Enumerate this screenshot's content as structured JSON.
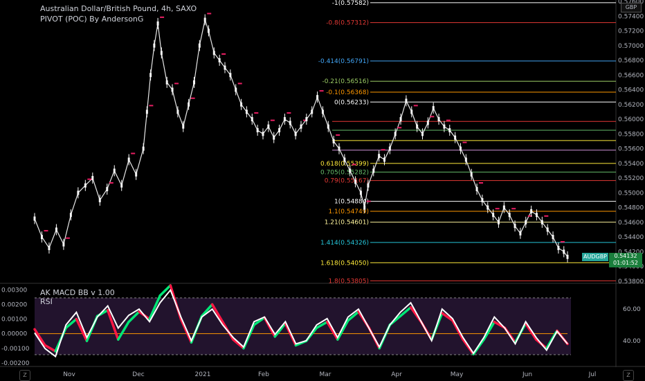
{
  "header": {
    "symbol_line": "Australian Dollar/British Pound, 4h, SAXO",
    "indicator_line": "PIVOT (POC) By AndersonG",
    "macd_label": "AK MACD BB v 1.00",
    "rsi_label": "RSI"
  },
  "axis": {
    "currency": "GBP",
    "symbol_tag": "AUDGBP",
    "last_price": "0.54132",
    "countdown": "01:01:52",
    "zoom_left": "Z",
    "zoom_right": "Z"
  },
  "colors": {
    "background": "#000000",
    "candle_up": "#ffffff",
    "candle_down": "#ffffff",
    "pivot_marker": "#e91e63",
    "macd_up": "#00e676",
    "macd_down": "#ff1744",
    "rsi_line": "#ffffff",
    "rsi_band": "#3b1f4d"
  },
  "chart_data": {
    "type": "line",
    "x_ticks": [
      "Nov",
      "Dec",
      "2021",
      "Feb",
      "Mar",
      "Apr",
      "May",
      "Jun",
      "Jul"
    ],
    "price_ylim": [
      0.5378,
      0.576
    ],
    "price_ticks": [
      "0.57600",
      "0.57400",
      "0.57200",
      "0.57000",
      "0.56800",
      "0.56600",
      "0.56400",
      "0.56200",
      "0.56000",
      "0.55800",
      "0.55600",
      "0.55400",
      "0.55200",
      "0.55000",
      "0.54800",
      "0.54600",
      "0.54400",
      "0.54200",
      "0.54000",
      "0.53800"
    ],
    "price_path": [
      [
        0,
        0.5465
      ],
      [
        8,
        0.544
      ],
      [
        16,
        0.5425
      ],
      [
        24,
        0.545
      ],
      [
        32,
        0.543
      ],
      [
        40,
        0.547
      ],
      [
        48,
        0.55
      ],
      [
        56,
        0.551
      ],
      [
        64,
        0.552
      ],
      [
        72,
        0.549
      ],
      [
        80,
        0.5505
      ],
      [
        88,
        0.553
      ],
      [
        96,
        0.551
      ],
      [
        104,
        0.5545
      ],
      [
        112,
        0.5525
      ],
      [
        120,
        0.556
      ],
      [
        124,
        0.561
      ],
      [
        128,
        0.566
      ],
      [
        132,
        0.57
      ],
      [
        136,
        0.573
      ],
      [
        140,
        0.569
      ],
      [
        146,
        0.565
      ],
      [
        152,
        0.564
      ],
      [
        158,
        0.561
      ],
      [
        164,
        0.559
      ],
      [
        170,
        0.562
      ],
      [
        176,
        0.565
      ],
      [
        182,
        0.57
      ],
      [
        188,
        0.5735
      ],
      [
        192,
        0.572
      ],
      [
        198,
        0.569
      ],
      [
        204,
        0.568
      ],
      [
        210,
        0.567
      ],
      [
        216,
        0.566
      ],
      [
        222,
        0.564
      ],
      [
        228,
        0.562
      ],
      [
        234,
        0.561
      ],
      [
        240,
        0.56
      ],
      [
        246,
        0.5585
      ],
      [
        252,
        0.558
      ],
      [
        258,
        0.559
      ],
      [
        264,
        0.5575
      ],
      [
        270,
        0.5585
      ],
      [
        276,
        0.56
      ],
      [
        282,
        0.5595
      ],
      [
        288,
        0.558
      ],
      [
        294,
        0.559
      ],
      [
        300,
        0.56
      ],
      [
        306,
        0.561
      ],
      [
        312,
        0.563
      ],
      [
        318,
        0.561
      ],
      [
        324,
        0.559
      ],
      [
        330,
        0.557
      ],
      [
        336,
        0.556
      ],
      [
        342,
        0.5545
      ],
      [
        348,
        0.553
      ],
      [
        354,
        0.5515
      ],
      [
        360,
        0.55
      ],
      [
        364,
        0.548
      ],
      [
        368,
        0.551
      ],
      [
        374,
        0.553
      ],
      [
        380,
        0.555
      ],
      [
        386,
        0.5545
      ],
      [
        392,
        0.556
      ],
      [
        398,
        0.558
      ],
      [
        404,
        0.56
      ],
      [
        410,
        0.5625
      ],
      [
        416,
        0.561
      ],
      [
        422,
        0.559
      ],
      [
        428,
        0.558
      ],
      [
        434,
        0.5595
      ],
      [
        440,
        0.5615
      ],
      [
        446,
        0.56
      ],
      [
        452,
        0.559
      ],
      [
        458,
        0.5585
      ],
      [
        464,
        0.5575
      ],
      [
        470,
        0.556
      ],
      [
        476,
        0.5545
      ],
      [
        482,
        0.5525
      ],
      [
        488,
        0.5505
      ],
      [
        494,
        0.549
      ],
      [
        500,
        0.548
      ],
      [
        506,
        0.547
      ],
      [
        512,
        0.546
      ],
      [
        518,
        0.548
      ],
      [
        524,
        0.547
      ],
      [
        530,
        0.5455
      ],
      [
        536,
        0.5445
      ],
      [
        542,
        0.546
      ],
      [
        548,
        0.5475
      ],
      [
        554,
        0.547
      ],
      [
        560,
        0.546
      ],
      [
        566,
        0.545
      ],
      [
        572,
        0.544
      ],
      [
        578,
        0.5425
      ],
      [
        584,
        0.542
      ],
      [
        588,
        0.5413
      ]
    ],
    "fib_levels": [
      {
        "label": "-1(0.57582)",
        "value": 0.57582,
        "color": "#ffffff"
      },
      {
        "label": "-0.8(0.57312)",
        "value": 0.57312,
        "color": "#e53935"
      },
      {
        "label": "-0.414(0.56791)",
        "value": 0.56791,
        "color": "#42a5f5"
      },
      {
        "label": "-0.21(0.56516)",
        "value": 0.56516,
        "color": "#9ccc65"
      },
      {
        "label": "-0.1(0.56368)",
        "value": 0.56368,
        "color": "#ff9800"
      },
      {
        "label": "0(0.56233)",
        "value": 0.56233,
        "color": "#ffffff"
      },
      {
        "label": "0.618(0.55399)",
        "value": 0.55399,
        "color": "#ffeb3b"
      },
      {
        "label": "0.705(0.55282)",
        "value": 0.55282,
        "color": "#66bb6a"
      },
      {
        "label": "0.79(0.55167)",
        "value": 0.55167,
        "color": "#e53935"
      },
      {
        "label": "1(0.54884)",
        "value": 0.54884,
        "color": "#ffffff"
      },
      {
        "label": "1.1(0.54749)",
        "value": 0.54749,
        "color": "#ff9800"
      },
      {
        "label": "1.21(0.54601)",
        "value": 0.54601,
        "color": "#fff59d"
      },
      {
        "label": "1.414(0.54326)",
        "value": 0.54326,
        "color": "#26c6da"
      },
      {
        "label": "1.618(0.54050)",
        "value": 0.5405,
        "color": "#ffeb3b"
      },
      {
        "label": "1.8(0.53805)",
        "value": 0.53805,
        "color": "#e53935"
      }
    ],
    "extra_level_lines": [
      {
        "value": 0.5597,
        "color": "#e53935"
      },
      {
        "value": 0.5585,
        "color": "#66bb6a"
      },
      {
        "value": 0.5571,
        "color": "#ffeb3b"
      },
      {
        "value": 0.5558,
        "color": "#ce93d8"
      }
    ],
    "macd_ylim": [
      -0.0021,
      0.0033
    ],
    "macd_ticks": [
      "0.00300",
      "0.00200",
      "0.00100",
      "0.00000",
      "-0.00100",
      "-0.00200"
    ],
    "macd_series": [
      0.0003,
      -0.0008,
      -0.0012,
      0.0004,
      0.001,
      -0.0005,
      0.0012,
      0.0016,
      -0.0004,
      0.0008,
      0.0015,
      0.001,
      0.0026,
      0.0033,
      0.001,
      -0.0006,
      0.0012,
      0.002,
      0.0008,
      -0.0004,
      -0.001,
      0.0006,
      0.0011,
      -0.0002,
      0.0007,
      -0.0008,
      -0.0005,
      0.0004,
      0.0008,
      -0.0004,
      0.0009,
      0.0015,
      0.0004,
      -0.001,
      0.0006,
      0.0012,
      0.0018,
      0.0008,
      -0.0004,
      0.0014,
      0.0009,
      -0.0004,
      -0.0014,
      -0.0004,
      0.0008,
      0.0004,
      -0.0006,
      0.0007,
      -0.0004,
      -0.001,
      0.0002,
      -0.0007
    ],
    "rsi_ticks": [
      "60.00",
      "40.00"
    ],
    "rsi_ylim": [
      25,
      75
    ],
    "rsi_series": [
      45,
      35,
      30,
      50,
      58,
      42,
      55,
      62,
      48,
      56,
      60,
      52,
      64,
      72,
      55,
      40,
      55,
      60,
      50,
      42,
      36,
      52,
      55,
      44,
      52,
      38,
      40,
      50,
      54,
      42,
      55,
      60,
      48,
      36,
      50,
      58,
      64,
      52,
      40,
      60,
      54,
      42,
      32,
      42,
      55,
      48,
      38,
      52,
      42,
      34,
      46,
      38
    ]
  }
}
